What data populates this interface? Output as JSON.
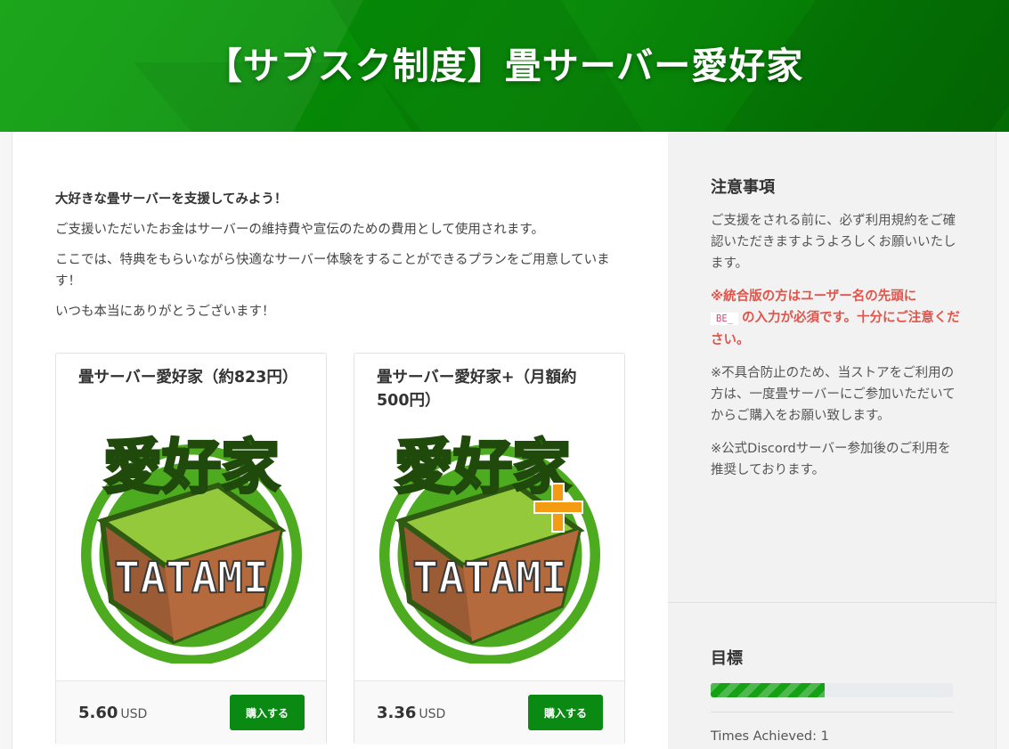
{
  "header": {
    "title": "【サブスク制度】畳サーバー愛好家"
  },
  "intro": {
    "lead": "大好きな畳サーバーを支援してみよう！",
    "p1": " ご支援いただいたお金はサーバーの維持費や宣伝のための費用として使用されます。",
    "p2": "ここでは、特典をもらいながら快適なサーバー体験をすることができるプランをご用意しています！",
    "p3": "いつも本当にありがとうございます！"
  },
  "packages": [
    {
      "title": "畳サーバー愛好家（約823円）",
      "price": "5.60",
      "currency": "USD",
      "buy_label": "購入する",
      "logo_text": "愛好家",
      "logo_word": "TATAMI",
      "has_plus": false
    },
    {
      "title": "畳サーバー愛好家+（月額約500円）",
      "price": "3.36",
      "currency": "USD",
      "buy_label": "購入する",
      "logo_text": "愛好家",
      "logo_word": "TATAMI",
      "has_plus": true
    }
  ],
  "sidebar": {
    "notice_title": "注意事項",
    "notice_p1": "ご支援をされる前に、必ず利用規約をご確認いただきますようよろしくお願いいたします。",
    "warn_prefix": "※統合版の方はユーザー名の先頭に",
    "warn_code": "BE_",
    "warn_suffix": "の入力が必須です。十分にご注意ください。",
    "notice_p2": "※不具合防止のため、当ストアをご利用の方は、一度畳サーバーにご参加いただいてからご購入をお願い致します。",
    "notice_p3": "※公式Discordサーバー参加後のご利用を推奨しております。",
    "goal_title": "目標",
    "goal_progress": 0.47,
    "times_achieved": "Times Achieved: 1"
  },
  "colors": {
    "brand_green": "#0a8a12",
    "warning_red": "#e0554b",
    "progress_green": "#14a214"
  },
  "icons": {
    "package_logo": "tatami-grass-block-logo",
    "plus_badge": "plus-icon"
  }
}
